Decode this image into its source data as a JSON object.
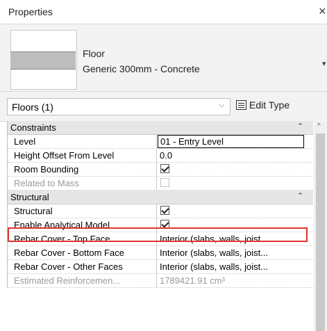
{
  "panel": {
    "title": "Properties",
    "close_glyph": "×"
  },
  "type_selector": {
    "family": "Floor",
    "type": "Generic 300mm - Concrete",
    "dropdown_glyph": "▾"
  },
  "instance_filter": {
    "value": "Floors (1)",
    "chevron": "⌵",
    "edit_type_label": "Edit Type"
  },
  "groups": [
    {
      "name": "Constraints",
      "collapse_glyph": "⌃",
      "rows": [
        {
          "name": "Level",
          "value": "01 - Entry Level"
        },
        {
          "name": "Height Offset From Level",
          "value": "0.0"
        },
        {
          "name": "Room Bounding",
          "checked": true
        },
        {
          "name": "Related to Mass",
          "checked": false,
          "disabled": true
        }
      ]
    },
    {
      "name": "Structural",
      "collapse_glyph": "⌃",
      "rows": [
        {
          "name": "Structural",
          "checked": true
        },
        {
          "name": "Enable Analytical Model",
          "checked": true
        },
        {
          "name": "Rebar Cover - Top Face",
          "value": "Interior (slabs, walls, joist..."
        },
        {
          "name": "Rebar Cover - Bottom Face",
          "value": "Interior (slabs, walls, joist..."
        },
        {
          "name": "Rebar Cover - Other Faces",
          "value": "Interior (slabs, walls, joist..."
        },
        {
          "name": "Estimated Reinforcemen...",
          "value": "1789421.91 cm³",
          "disabled": true
        }
      ]
    }
  ],
  "scrollbar": {
    "up_glyph": "^"
  },
  "colors": {
    "highlight": "#e0332f",
    "group_header_bg": "#e6e6e6"
  }
}
